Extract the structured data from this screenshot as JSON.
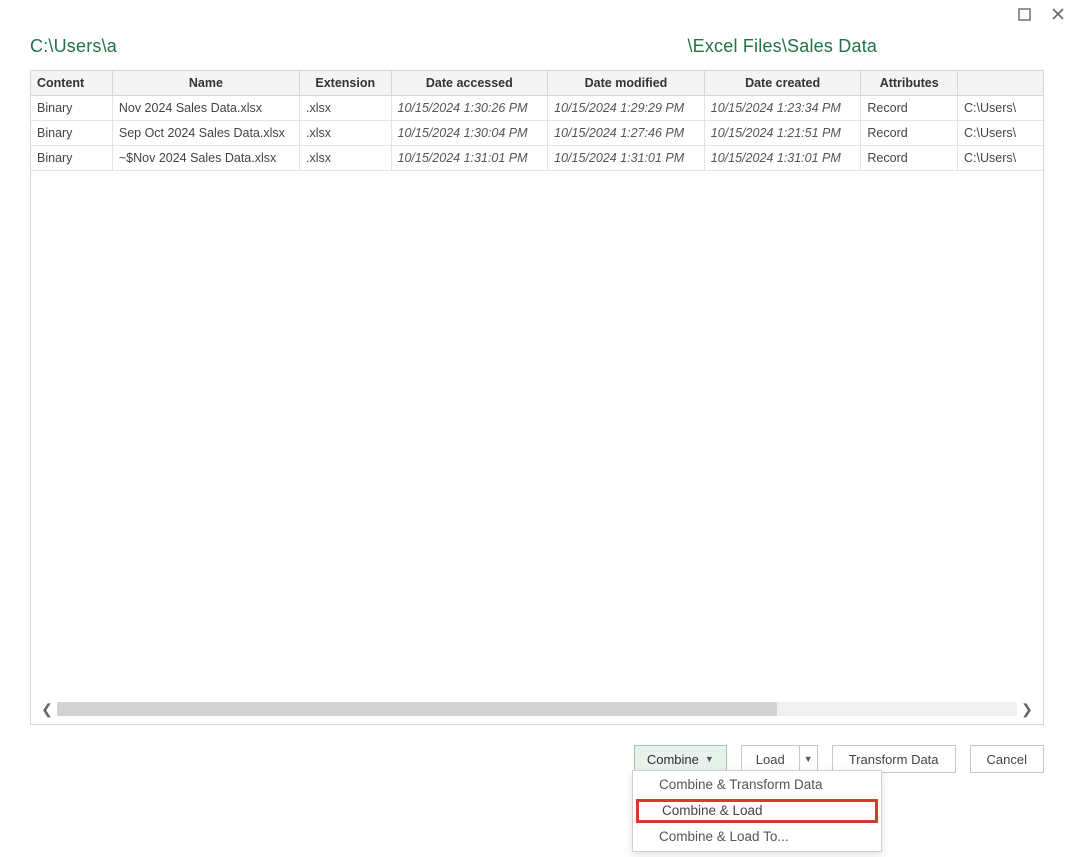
{
  "window": {
    "maximize_tooltip": "Maximize",
    "close_tooltip": "Close"
  },
  "path": {
    "prefix": "C:\\Users\\a",
    "suffix": "\\Excel Files\\Sales Data"
  },
  "columns": {
    "content": "Content",
    "name": "Name",
    "extension": "Extension",
    "date_accessed": "Date accessed",
    "date_modified": "Date modified",
    "date_created": "Date created",
    "attributes": "Attributes",
    "folder_hint": "C:\\Users\\"
  },
  "rows": [
    {
      "content": "Binary",
      "name": "Nov 2024 Sales Data.xlsx",
      "extension": ".xlsx",
      "date_accessed": "10/15/2024 1:30:26 PM",
      "date_modified": "10/15/2024 1:29:29 PM",
      "date_created": "10/15/2024 1:23:34 PM",
      "attributes": "Record",
      "folder": "C:\\Users\\"
    },
    {
      "content": "Binary",
      "name": "Sep Oct 2024 Sales Data.xlsx",
      "extension": ".xlsx",
      "date_accessed": "10/15/2024 1:30:04 PM",
      "date_modified": "10/15/2024 1:27:46 PM",
      "date_created": "10/15/2024 1:21:51 PM",
      "attributes": "Record",
      "folder": "C:\\Users\\"
    },
    {
      "content": "Binary",
      "name": "~$Nov 2024 Sales Data.xlsx",
      "extension": ".xlsx",
      "date_accessed": "10/15/2024 1:31:01 PM",
      "date_modified": "10/15/2024 1:31:01 PM",
      "date_created": "10/15/2024 1:31:01 PM",
      "attributes": "Record",
      "folder": "C:\\Users\\"
    }
  ],
  "buttons": {
    "combine": "Combine",
    "load": "Load",
    "transform": "Transform Data",
    "cancel": "Cancel"
  },
  "menu": {
    "combine_transform": "Combine & Transform Data",
    "combine_load": "Combine & Load",
    "combine_load_to": "Combine & Load To..."
  }
}
